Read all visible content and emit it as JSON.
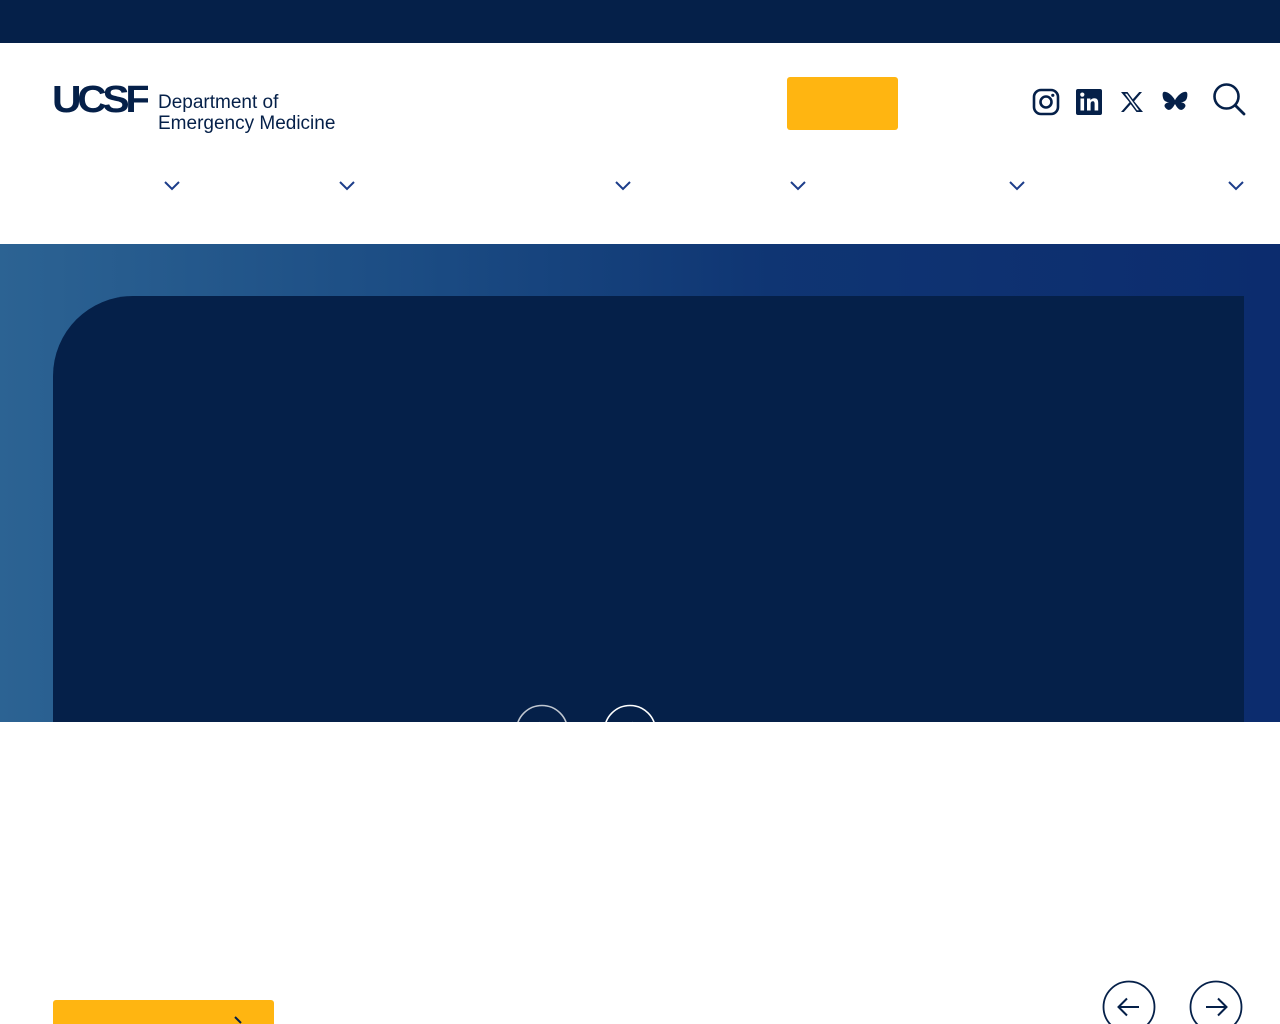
{
  "logo": {
    "mark": "UCSF",
    "line1": "Department of",
    "line2": "Emergency Medicine"
  },
  "header": {
    "cta_label": ""
  },
  "social": {
    "items": [
      "instagram-icon",
      "linkedin-icon",
      "x-icon",
      "bluesky-icon"
    ]
  },
  "icons": {
    "search": "search-icon",
    "chevron": "chevron-down-icon",
    "arrow_left": "arrow-left-icon",
    "arrow_right": "arrow-right-icon"
  },
  "colors": {
    "navy": "#052049",
    "gold": "#ffb511",
    "white": "#ffffff"
  }
}
